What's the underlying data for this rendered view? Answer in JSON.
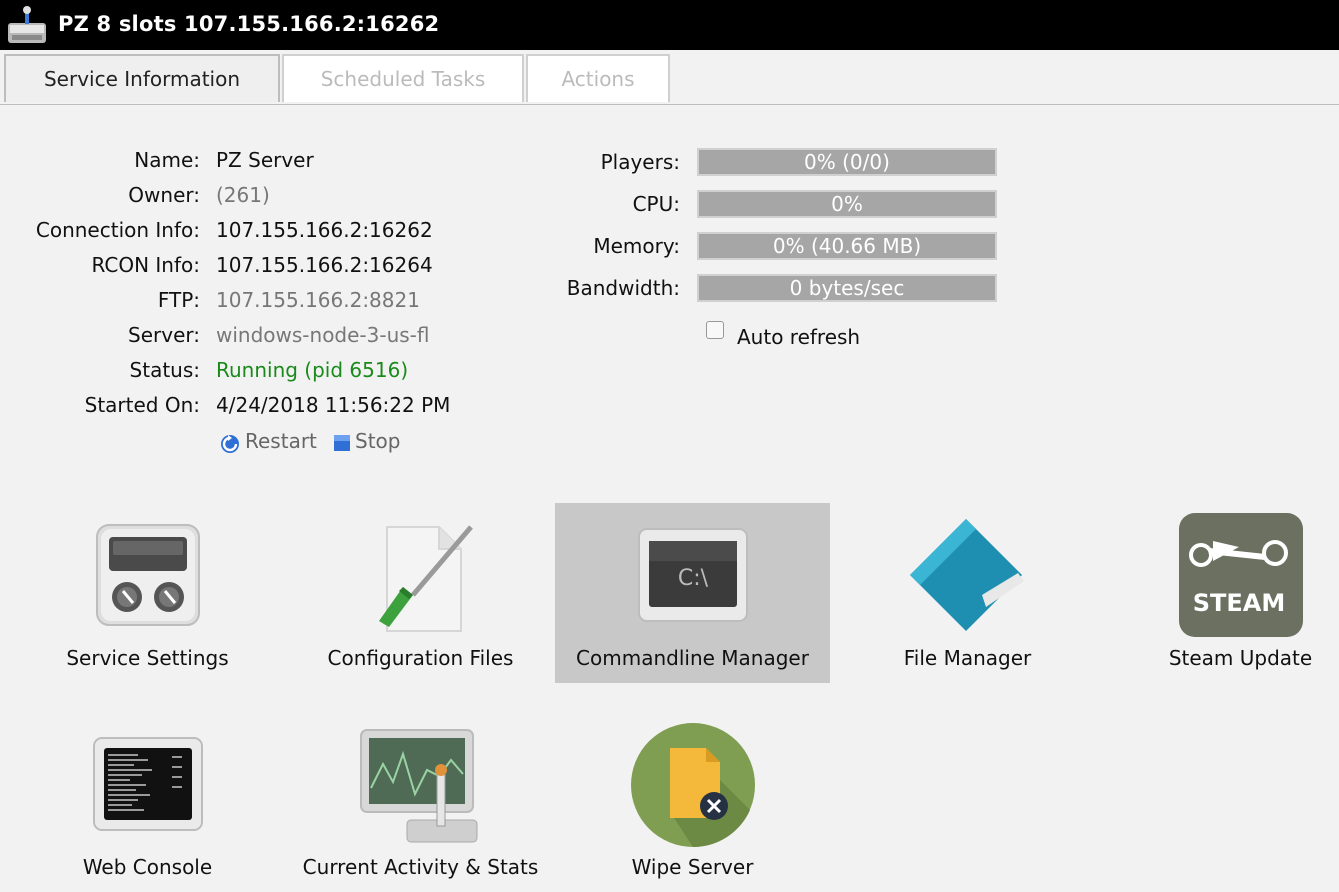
{
  "window": {
    "title": "PZ 8 slots 107.155.166.2:16262"
  },
  "tabs": [
    {
      "label": "Service Information",
      "active": true
    },
    {
      "label": "Scheduled Tasks",
      "active": false
    },
    {
      "label": "Actions",
      "active": false
    }
  ],
  "info": {
    "name": {
      "label": "Name:",
      "value": "PZ Server"
    },
    "owner": {
      "label": "Owner:",
      "value": "(261)"
    },
    "connection": {
      "label": "Connection Info:",
      "value": "107.155.166.2:16262"
    },
    "rcon": {
      "label": "RCON Info:",
      "value": "107.155.166.2:16264"
    },
    "ftp": {
      "label": "FTP:",
      "value": "107.155.166.2:8821"
    },
    "server": {
      "label": "Server:",
      "value": "windows-node-3-us-fl"
    },
    "status": {
      "label": "Status:",
      "value": "Running (pid 6516)"
    },
    "started": {
      "label": "Started On:",
      "value": "4/24/2018 11:56:22 PM"
    }
  },
  "actions": {
    "restart": "Restart",
    "stop": "Stop"
  },
  "stats": {
    "players": {
      "label": "Players:",
      "value": "0% (0/0)",
      "percent": 0
    },
    "cpu": {
      "label": "CPU:",
      "value": "0%",
      "percent": 0
    },
    "memory": {
      "label": "Memory:",
      "value": "0% (40.66 MB)",
      "percent": 0
    },
    "bandwidth": {
      "label": "Bandwidth:",
      "value": "0 bytes/sec"
    }
  },
  "auto_refresh": {
    "label": "Auto refresh",
    "checked": false
  },
  "tiles": {
    "service_settings": "Service Settings",
    "config_files": "Configuration Files",
    "commandline_manager": "Commandline Manager",
    "file_manager": "File Manager",
    "steam_update": "Steam Update",
    "web_console": "Web Console",
    "activity_stats": "Current Activity & Stats",
    "wipe_server": "Wipe Server"
  },
  "icon_text": {
    "cmd": "C:\\",
    "steam": "STEAM"
  },
  "colors": {
    "status_green": "#1a8a1a",
    "bar_fill": "#a6a6a6",
    "titlebar": "#000000"
  }
}
